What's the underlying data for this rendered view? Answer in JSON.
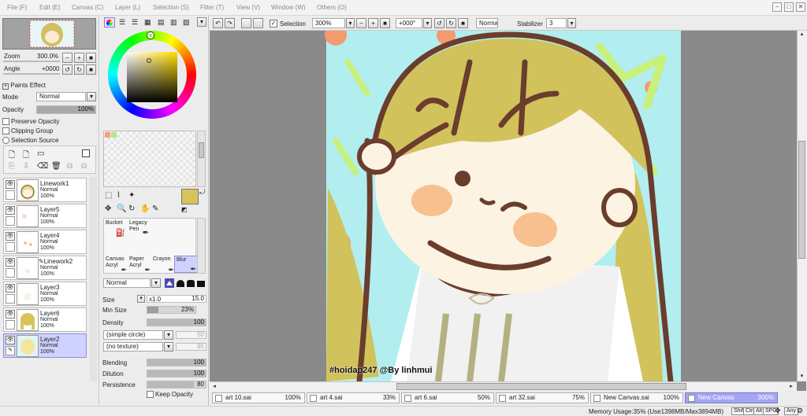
{
  "menu": {
    "items": [
      "File (F)",
      "Edit (E)",
      "Canvas (C)",
      "Layer (L)",
      "Selection (S)",
      "Filter (T)",
      "View (V)",
      "Window (W)",
      "Others (O)"
    ],
    "window_buttons": [
      "−",
      "□",
      "✕"
    ]
  },
  "navigator": {
    "zoom_label": "Zoom",
    "zoom_value": "300.0%",
    "angle_label": "Angle",
    "angle_value": "+0000"
  },
  "layer_props": {
    "paints_effect": "Paints Effect",
    "mode_label": "Mode",
    "mode_value": "Normal",
    "opacity_label": "Opacity",
    "opacity_value": "100%",
    "opacity_fraction": 1.0,
    "preserve_opacity": "Preserve Opacity",
    "clipping_group": "Clipping Group",
    "selection_source": "Selection Source"
  },
  "layers": [
    {
      "name": "Linework1",
      "mode": "Normal",
      "opacity": "100%",
      "selected": false
    },
    {
      "name": "Layer5",
      "mode": "Normal",
      "opacity": "100%",
      "selected": false
    },
    {
      "name": "Layer4",
      "mode": "Normal",
      "opacity": "100%",
      "selected": false
    },
    {
      "name": "Linework2",
      "mode": "Normal",
      "opacity": "100%",
      "selected": false
    },
    {
      "name": "Layer3",
      "mode": "Normal",
      "opacity": "100%",
      "selected": false
    },
    {
      "name": "Layer6",
      "mode": "Normal",
      "opacity": "100%",
      "selected": false
    },
    {
      "name": "Layer2",
      "mode": "Normal",
      "opacity": "100%",
      "selected": true
    }
  ],
  "colors": {
    "primary": "#d7c35a",
    "secondary": "#ffffff",
    "swatch1": "#f4a07a",
    "swatch2": "#b9e48a",
    "selected_layer": "#cfd2ff",
    "active_tab": "#a5a5f5"
  },
  "tools": {
    "top_row": [
      {
        "line1": "Bucket",
        "line2": ""
      },
      {
        "line1": "Legacy",
        "line2": "Pen"
      }
    ],
    "bottom_row": [
      {
        "line1": "Canvas",
        "line2": "Acryl"
      },
      {
        "line1": "Paper",
        "line2": "Acryl"
      },
      {
        "line1": "Crayon",
        "line2": ""
      },
      {
        "line1": "Blur",
        "line2": ""
      }
    ]
  },
  "brush": {
    "blend_mode": "Normal",
    "size_label": "Size",
    "size_mult": "x1.0",
    "size_value": "15.0",
    "min_size_label": "Min Size",
    "min_size_value": "23%",
    "min_size_fraction": 0.23,
    "density_label": "Density",
    "density_value": "100",
    "density_fraction": 1.0,
    "shape": "(simple circle)",
    "shape_value": "50",
    "texture": "(no texture)",
    "texture_value": "95",
    "blending_label": "Blending",
    "blending_value": "100",
    "blending_fraction": 1.0,
    "dilution_label": "Dilution",
    "dilution_value": "100",
    "dilution_fraction": 1.0,
    "persistence_label": "Persistence",
    "persistence_value": "80",
    "persistence_fraction": 0.8,
    "keep_opacity": "Keep Opacity"
  },
  "toolbar": {
    "selection_label": "Selection",
    "zoom": "300%",
    "angle": "+000°",
    "mode": "Normal",
    "stabilizer_label": "Stabilizer",
    "stabilizer_value": "3"
  },
  "canvas": {
    "watermark": "#hoidap247 @By linhmui"
  },
  "tabs": [
    {
      "name": "art 10.sai",
      "pct": "100%",
      "active": false
    },
    {
      "name": "art 4.sai",
      "pct": "33%",
      "active": false
    },
    {
      "name": "art 6.sai",
      "pct": "50%",
      "active": false
    },
    {
      "name": "art 32.sai",
      "pct": "75%",
      "active": false
    },
    {
      "name": "New Canvas.sai",
      "pct": "100%",
      "active": false
    },
    {
      "name": "New Canvas",
      "pct": "300%",
      "active": true
    }
  ],
  "status": {
    "memory": "Memory Usage:35% (Use1398MB/Max3894MB)",
    "keys": [
      "Shift",
      "Ctrl",
      "Alt",
      "SPC",
      "Any"
    ]
  }
}
